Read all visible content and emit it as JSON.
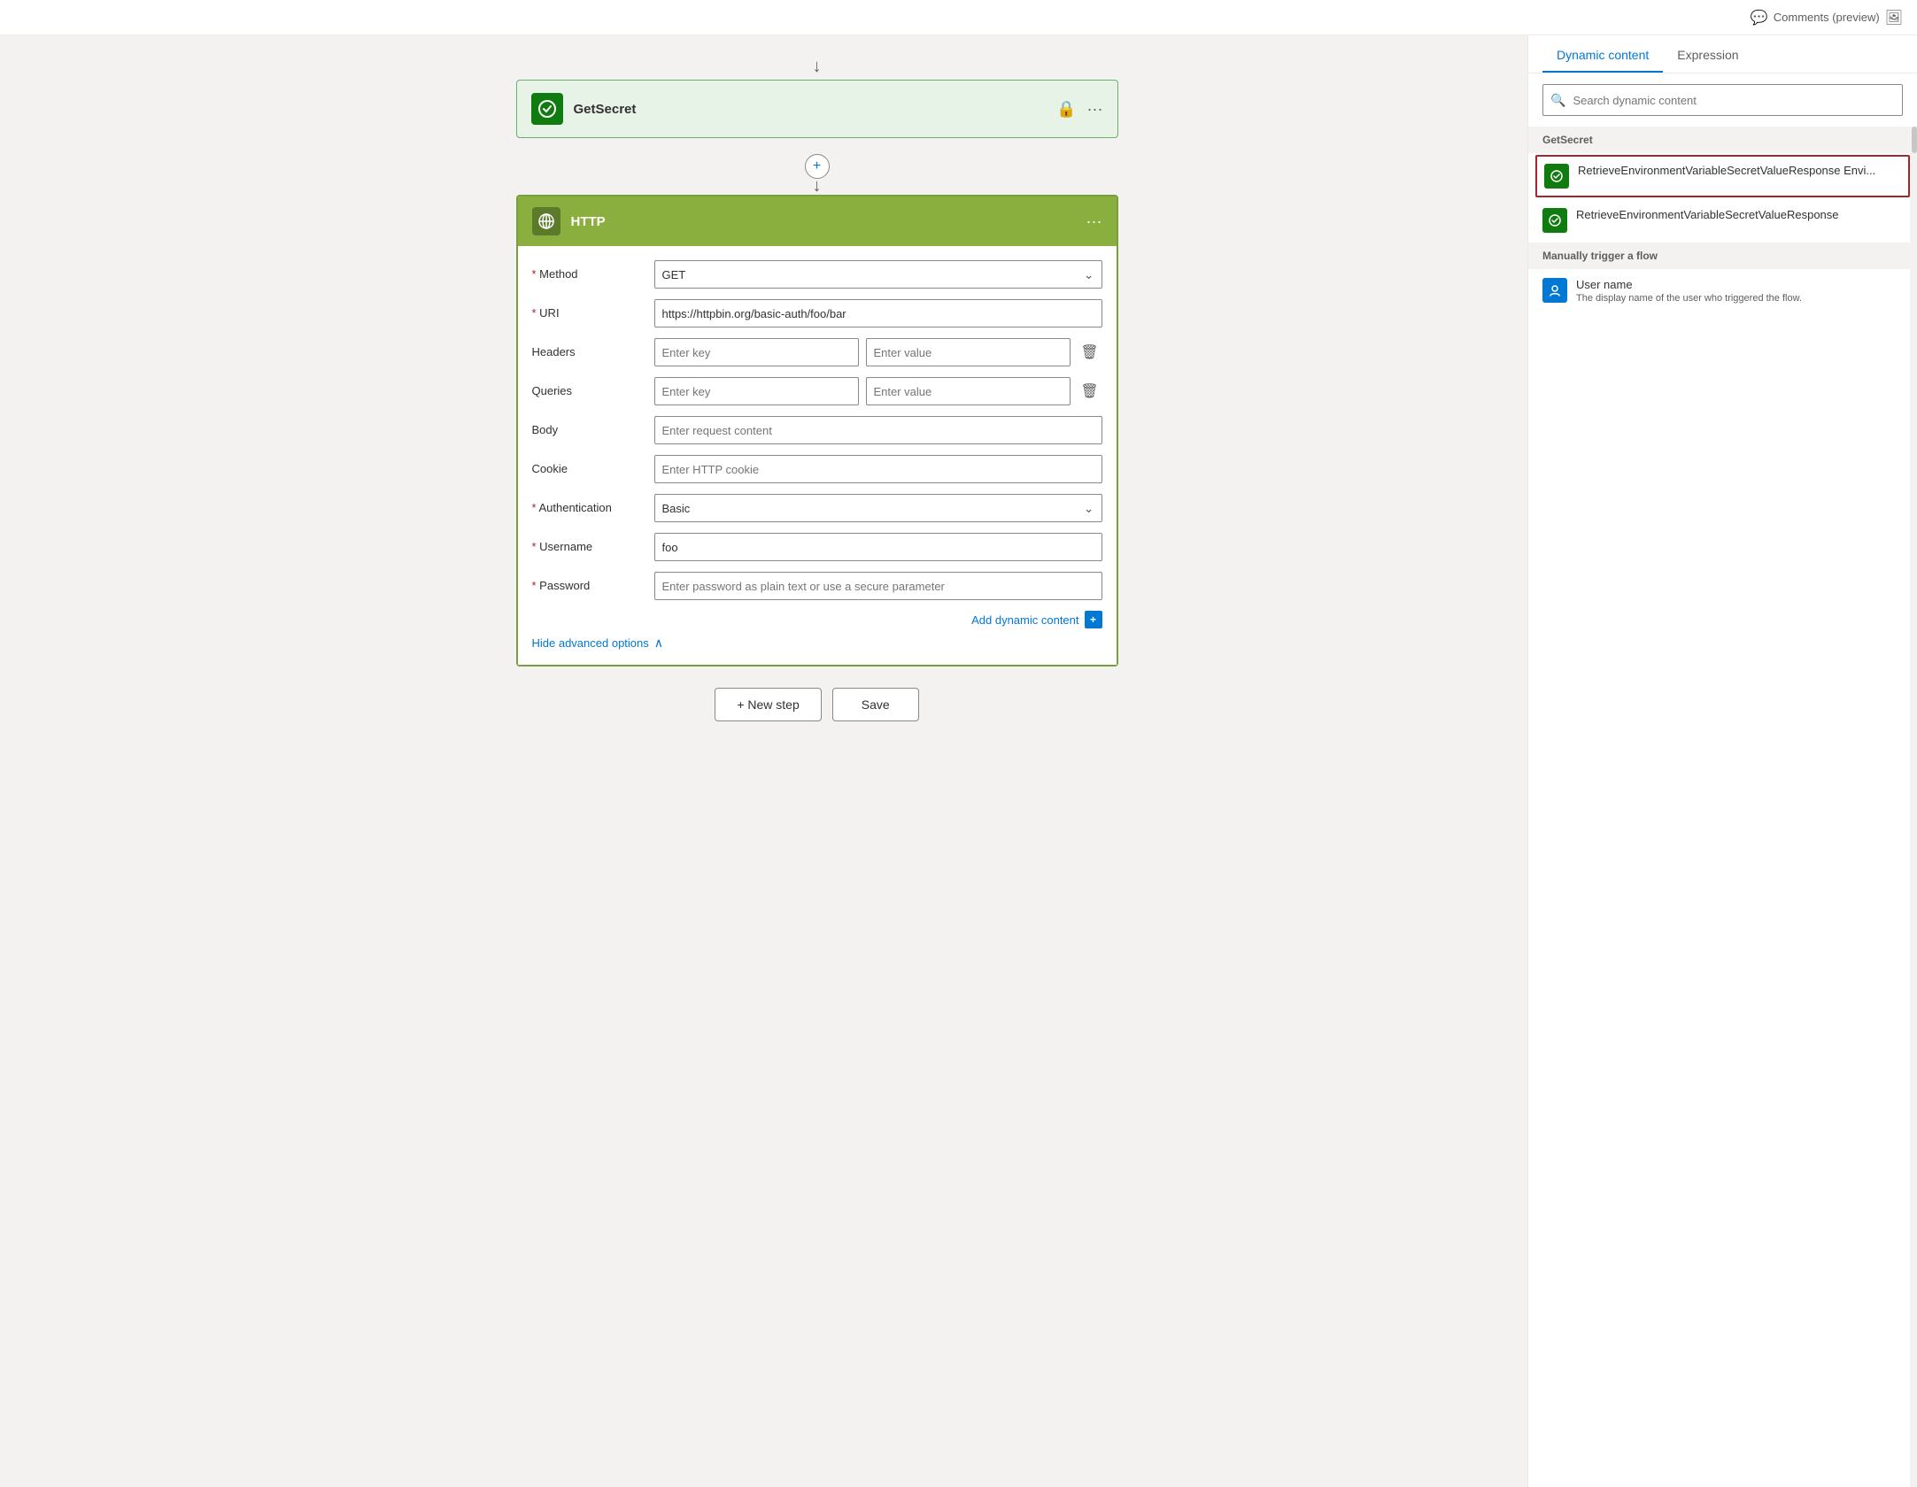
{
  "topbar": {
    "comments_label": "Comments (preview)"
  },
  "getsecret_card": {
    "title": "GetSecret",
    "lock_icon": "🔒",
    "more_icon": "···"
  },
  "http_card": {
    "title": "HTTP",
    "more_icon": "···",
    "fields": {
      "method_label": "Method",
      "method_value": "GET",
      "uri_label": "URI",
      "uri_value": "https://httpbin.org/basic-auth/foo/bar",
      "headers_label": "Headers",
      "headers_key_placeholder": "Enter key",
      "headers_value_placeholder": "Enter value",
      "queries_label": "Queries",
      "queries_key_placeholder": "Enter key",
      "queries_value_placeholder": "Enter value",
      "body_label": "Body",
      "body_placeholder": "Enter request content",
      "cookie_label": "Cookie",
      "cookie_placeholder": "Enter HTTP cookie",
      "authentication_label": "Authentication",
      "authentication_value": "Basic",
      "username_label": "Username",
      "username_value": "foo",
      "password_label": "Password",
      "password_placeholder": "Enter password as plain text or use a secure parameter"
    },
    "dynamic_content_link": "Add dynamic content",
    "hide_advanced": "Hide advanced options"
  },
  "bottom_actions": {
    "new_step": "+ New step",
    "save": "Save"
  },
  "dynamic_panel": {
    "tab_dynamic": "Dynamic content",
    "tab_expression": "Expression",
    "search_placeholder": "Search dynamic content",
    "section_getsecret": "GetSecret",
    "item1_title": "RetrieveEnvironmentVariableSecretValueResponse Envi...",
    "item2_title": "RetrieveEnvironmentVariableSecretValueResponse",
    "section_manually": "Manually trigger a flow",
    "item3_title": "User name",
    "item3_desc": "The display name of the user who triggered the flow."
  }
}
